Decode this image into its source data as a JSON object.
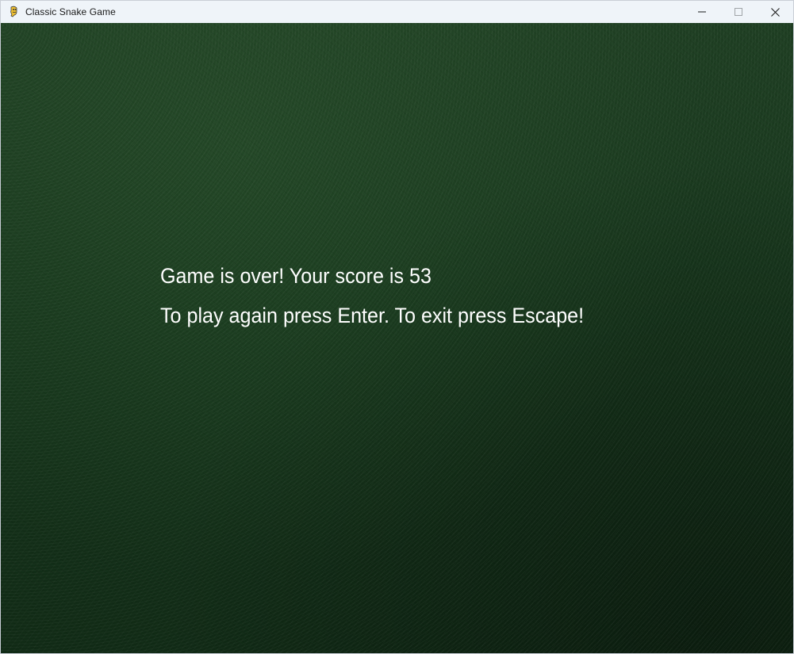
{
  "window": {
    "title": "Classic Snake Game",
    "icon": "pygame-snake-icon",
    "controls": {
      "minimize_icon": "minimize-icon",
      "maximize_icon": "maximize-icon",
      "close_icon": "close-icon"
    }
  },
  "game_over": {
    "line1": "Game is over! Your score is 53",
    "line2": "To play again press Enter. To exit press Escape!",
    "score": 53
  },
  "colors": {
    "background": "#17361c",
    "text": "#ffffff",
    "titlebar": "#eff4f9"
  }
}
